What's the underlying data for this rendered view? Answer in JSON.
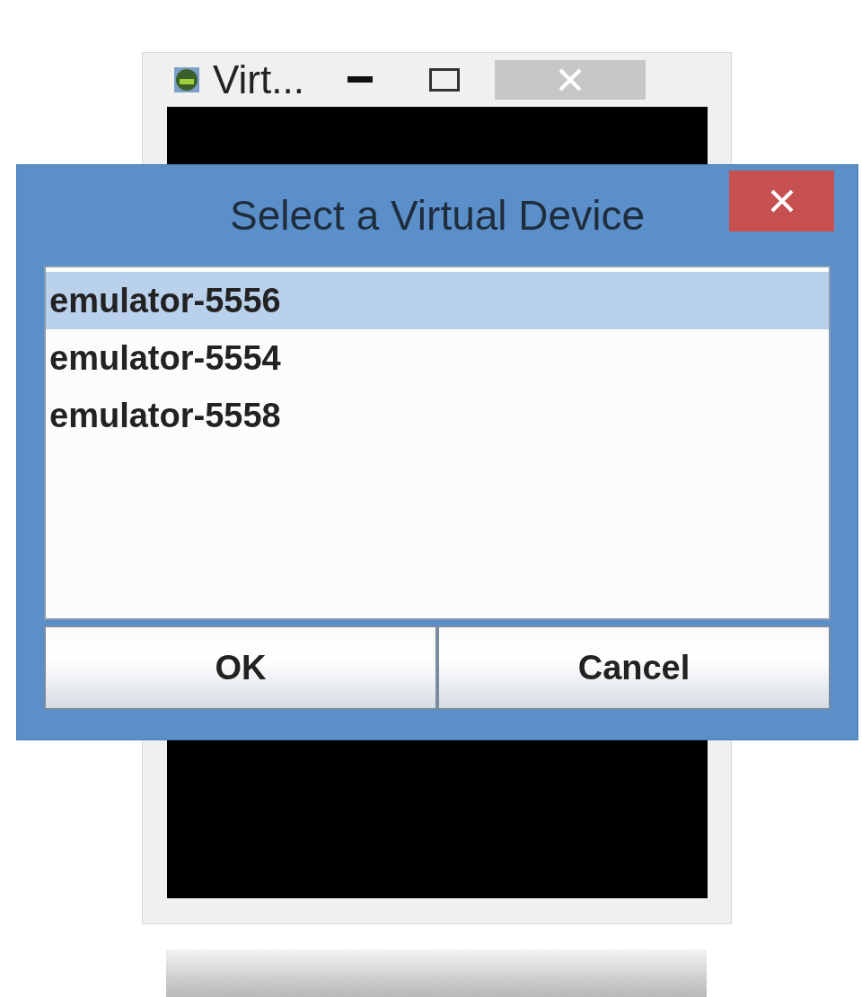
{
  "background_window": {
    "title": "Virt..."
  },
  "dialog": {
    "title": "Select a Virtual Device",
    "devices": [
      {
        "name": "emulator-5556",
        "selected": true
      },
      {
        "name": "emulator-5554",
        "selected": false
      },
      {
        "name": "emulator-5558",
        "selected": false
      }
    ],
    "buttons": [
      "OK",
      "Cancel"
    ]
  }
}
